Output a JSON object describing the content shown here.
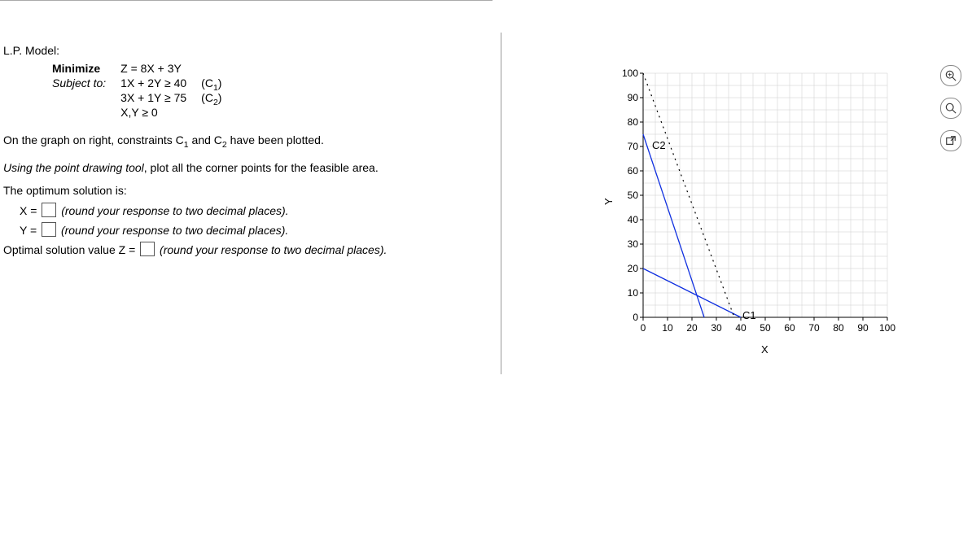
{
  "title": "L.P. Model:",
  "formulation": {
    "obj_label": "Minimize",
    "obj_expr": "Z = 8X + 3Y",
    "st_label": "Subject to:",
    "c1": "1X + 2Y ≥ 40",
    "c1_name": "(C",
    "c1_sub": "1",
    "c1_close": ")",
    "c2": "3X + 1Y ≥ 75",
    "c2_name": "(C",
    "c2_sub": "2",
    "c2_close": ")",
    "nn": "X,Y ≥ 0"
  },
  "para1a": "On the graph on right, constraints C",
  "para1b": " and C",
  "para1c": " have been plotted.",
  "para2a": "Using the point drawing tool",
  "para2b": ", plot all the corner points for the feasible area.",
  "answers": {
    "lead": "The optimum solution is:",
    "x_lbl": "X =",
    "x_hint": "(round your response to two decimal places).",
    "y_lbl": "Y =",
    "y_hint": "(round your response to two decimal places).",
    "z_lbl": "Optimal solution value Z  =",
    "z_hint": "(round your response to two decimal places)."
  },
  "chart": {
    "xlabel": "X",
    "ylabel": "Y",
    "c1_text": "C1",
    "c2_text": "C2",
    "xticks": [
      "0",
      "10",
      "20",
      "30",
      "40",
      "50",
      "60",
      "70",
      "80",
      "90",
      "100"
    ],
    "yticks": [
      "0",
      "10",
      "20",
      "30",
      "40",
      "50",
      "60",
      "70",
      "80",
      "90",
      "100"
    ]
  },
  "chart_data": {
    "type": "line",
    "xlabel": "X",
    "ylabel": "Y",
    "xlim": [
      0,
      100
    ],
    "ylim": [
      0,
      100
    ],
    "grid": true,
    "series": [
      {
        "name": "C1",
        "style": "dotted",
        "color": "#000000",
        "points": [
          [
            0,
            100
          ],
          [
            40,
            0
          ]
        ],
        "note": "Objective / iso-Z dashed line crossing (0,100)-(~37.5,0) visually"
      },
      {
        "name": "C1_line",
        "style": "solid",
        "color": "#1040ff",
        "points": [
          [
            0,
            20
          ],
          [
            40,
            0
          ]
        ],
        "equation": "1X + 2Y = 40"
      },
      {
        "name": "C2",
        "style": "solid",
        "color": "#1040ff",
        "points": [
          [
            0,
            75
          ],
          [
            25,
            0
          ]
        ],
        "equation": "3X + 1Y = 75"
      }
    ],
    "labels": [
      {
        "text": "C2",
        "x": 4,
        "y": 70
      },
      {
        "text": "C1",
        "x": 42,
        "y": 2
      }
    ]
  }
}
